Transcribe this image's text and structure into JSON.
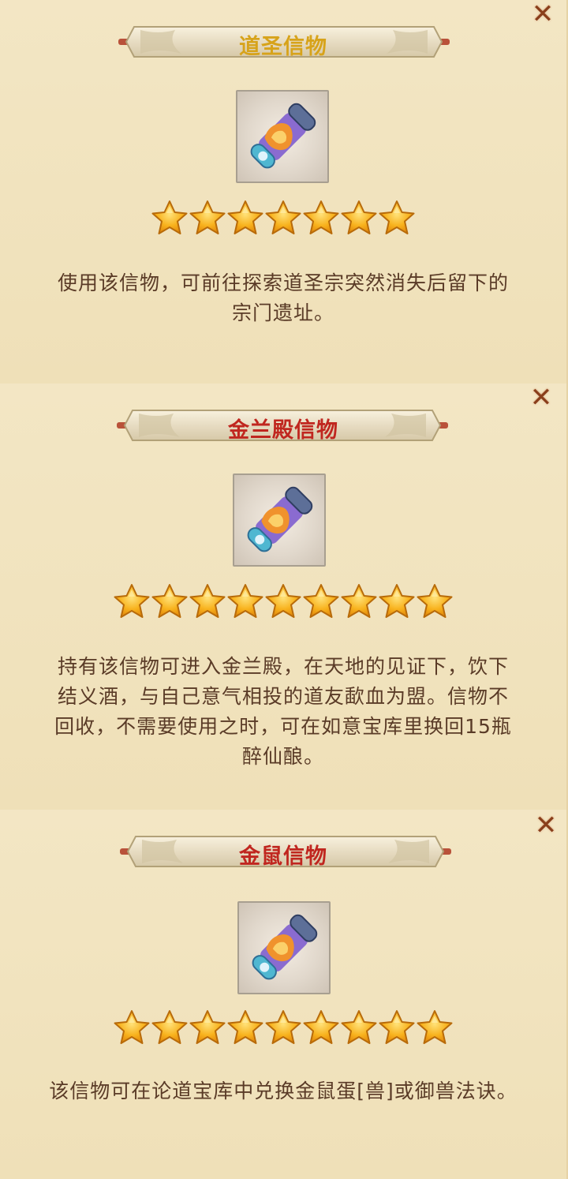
{
  "cards": [
    {
      "title": "道圣信物",
      "title_color": "#d7a31a",
      "star_count": 7,
      "description_lines": [
        "使用该信物，可前往探索道圣宗突然消失后留下的",
        "宗门遗址。"
      ]
    },
    {
      "title": "金兰殿信物",
      "title_color": "#c0261f",
      "star_count": 9,
      "description_lines": [
        "持有该信物可进入金兰殿，在天地的见证下，饮下",
        "结义酒，与自己意气相投的道友歃血为盟。信物不",
        "回收，不需要使用之时，可在如意宝库里换回15瓶",
        "醉仙酿。"
      ]
    },
    {
      "title": "金鼠信物",
      "title_color": "#c0261f",
      "star_count": 9,
      "description_lines": [
        "该信物可在论道宝库中兑换金鼠蛋[兽]或御兽法诀。"
      ]
    }
  ],
  "icons": {
    "close": "close-x-icon",
    "star": "star-icon",
    "item": "scroll-token-icon"
  },
  "colors": {
    "panel_bg": "#f1e3be",
    "desc_text": "#5a3b27",
    "close": "#8a3f1b",
    "star_fill": "#f5a516"
  }
}
